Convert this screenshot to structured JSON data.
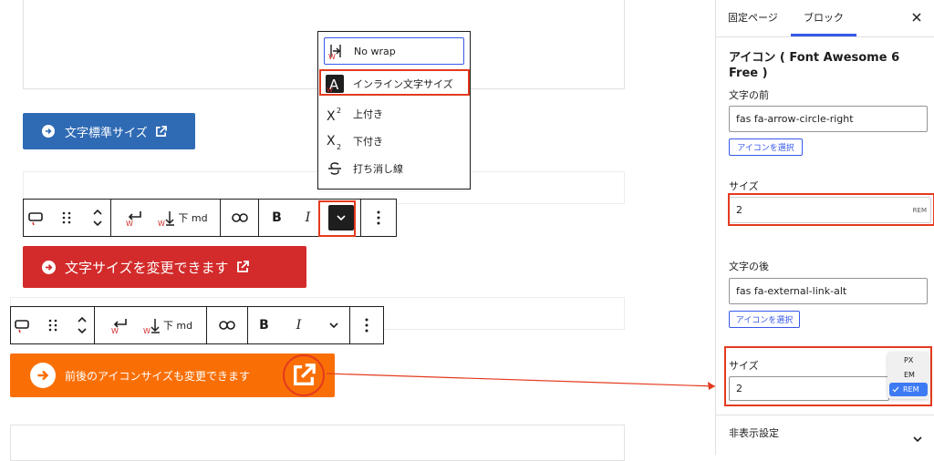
{
  "editor": {
    "button1_label": "文字標準サイズ",
    "button2_label": "文字サイズを変更できます",
    "button3_label": "前後のアイコンサイズも変更できます",
    "colors": {
      "blue": "#2f6ab4",
      "red": "#d32b2b",
      "orange": "#f96f06",
      "highlight": "#e43a1f"
    }
  },
  "toolbar1": {
    "anchor_label": "下 md"
  },
  "toolbar2": {
    "anchor_label": "下 md"
  },
  "format_menu": {
    "items": [
      {
        "label": "No wrap",
        "icon": "no-wrap-icon"
      },
      {
        "label": "インライン文字サイズ",
        "icon": "inline-font-size-icon"
      },
      {
        "label": "上付き",
        "icon": "superscript-icon"
      },
      {
        "label": "下付き",
        "icon": "subscript-icon"
      },
      {
        "label": "打ち消し線",
        "icon": "strikethrough-icon"
      }
    ]
  },
  "sidebar": {
    "tabs": [
      "固定ページ",
      "ブロック"
    ],
    "panel_title": "アイコン ( Font Awesome 6 Free )",
    "before_label": "文字の前",
    "before_value": "fas fa-arrow-circle-right",
    "select_icon_label": "アイコンを選択",
    "size_label": "サイズ",
    "size_value": "2",
    "unit_rem": "REM",
    "after_label": "文字の後",
    "after_value": "fas fa-external-link-alt",
    "size2_label": "サイズ",
    "size2_value": "2",
    "unit_options": [
      "PX",
      "EM",
      "REM"
    ],
    "hidden_label": "非表示設定"
  }
}
